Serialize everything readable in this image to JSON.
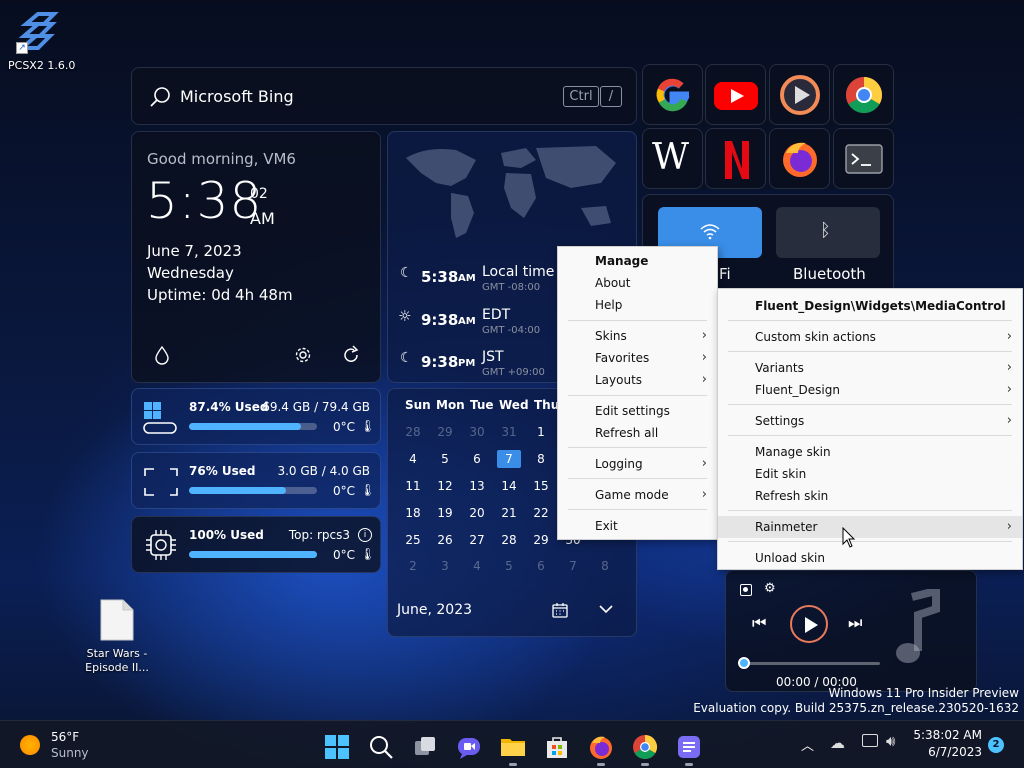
{
  "desktop": {
    "pcsx2_label": "PCSX2 1.6.0",
    "file_label_line1": "Star Wars -",
    "file_label_line2": "Episode II...",
    "watermark_line1": "Windows 11 Pro Insider Preview",
    "watermark_line2": "Evaluation copy. Build 25375.zn_release.230520-1632"
  },
  "search": {
    "text": "Microsoft Bing",
    "key1": "Ctrl",
    "key2": "/"
  },
  "clock": {
    "greeting": "Good morning, VM6",
    "time": "5:38",
    "seconds": "02",
    "ampm": "AM",
    "date": "June 7, 2023",
    "weekday": "Wednesday",
    "uptime": "Uptime: 0d 4h 48m"
  },
  "stats": {
    "disk": {
      "used": "87.4% Used",
      "detail": "69.4 GB / 79.4 GB",
      "temp": "0°C",
      "fill": 0.874
    },
    "ram": {
      "used": "76% Used",
      "detail": "3.0 GB / 4.0 GB",
      "temp": "0°C",
      "fill": 0.76
    },
    "cpu": {
      "used": "100% Used",
      "detail": "Top: rpcs3",
      "temp": "0°C",
      "fill": 1.0
    }
  },
  "world_clock": [
    {
      "time": "5:38",
      "ampm": "AM",
      "zone": "Local time",
      "offset": "GMT -08:00",
      "icon": "moon-icon"
    },
    {
      "time": "9:38",
      "ampm": "AM",
      "zone": "EDT",
      "offset": "GMT -04:00",
      "icon": "sun-icon"
    },
    {
      "time": "9:38",
      "ampm": "PM",
      "zone": "JST",
      "offset": "GMT +09:00",
      "icon": "moon-icon"
    }
  ],
  "calendar": {
    "days": [
      "Sun",
      "Mon",
      "Tue",
      "Wed",
      "Thu"
    ],
    "rows": [
      [
        "28",
        "29",
        "30",
        "31",
        "1"
      ],
      [
        "4",
        "5",
        "6",
        "7",
        "8"
      ],
      [
        "11",
        "12",
        "13",
        "14",
        "15"
      ],
      [
        "18",
        "19",
        "20",
        "21",
        "22"
      ],
      [
        "25",
        "26",
        "27",
        "28",
        "29"
      ],
      [
        "2",
        "3",
        "4",
        "5",
        "6",
        "7",
        "8"
      ]
    ],
    "extra_30": "30",
    "today": "7",
    "month_label": "June, 2023"
  },
  "shortcuts": [
    "google-icon",
    "youtube-icon",
    "media-player-icon",
    "chrome-icon",
    "wikipedia-icon",
    "netflix-icon",
    "firefox-icon",
    "terminal-icon"
  ],
  "toggles": {
    "wifi_suffix": "Fi",
    "bluetooth": "Bluetooth"
  },
  "main_menu": {
    "items": [
      {
        "label": "Manage",
        "bold": true
      },
      {
        "label": "About"
      },
      {
        "label": "Help"
      },
      {
        "label": "Skins",
        "arrow": "›"
      },
      {
        "label": "Favorites",
        "arrow": "›"
      },
      {
        "label": "Layouts",
        "arrow": "›"
      },
      {
        "label": "Edit settings"
      },
      {
        "label": "Refresh all"
      },
      {
        "label": "Logging",
        "arrow": "›"
      },
      {
        "label": "Game mode",
        "arrow": "›"
      },
      {
        "label": "Exit"
      }
    ]
  },
  "skin_menu": {
    "title": "Fluent_Design\\Widgets\\MediaControl",
    "items": [
      {
        "label": "Custom skin actions",
        "arrow": "›"
      },
      {
        "label": "Variants",
        "arrow": "›"
      },
      {
        "label": "Fluent_Design",
        "arrow": "›"
      },
      {
        "label": "Settings",
        "arrow": "›"
      },
      {
        "label": "Manage skin"
      },
      {
        "label": "Edit skin"
      },
      {
        "label": "Refresh skin"
      },
      {
        "label": "Rainmeter",
        "arrow": "›"
      },
      {
        "label": "Unload skin"
      }
    ]
  },
  "media": {
    "position": "00:00 / 00:00",
    "progress": 0.0
  },
  "taskbar": {
    "weather_temp": "56°F",
    "weather_desc": "Sunny",
    "time": "5:38:02 AM",
    "date": "6/7/2023",
    "notification_count": "2"
  },
  "colors": {
    "accent": "#4fb3ff",
    "wifi_on": "#3a8ee8",
    "today": "#3a8ee8"
  }
}
